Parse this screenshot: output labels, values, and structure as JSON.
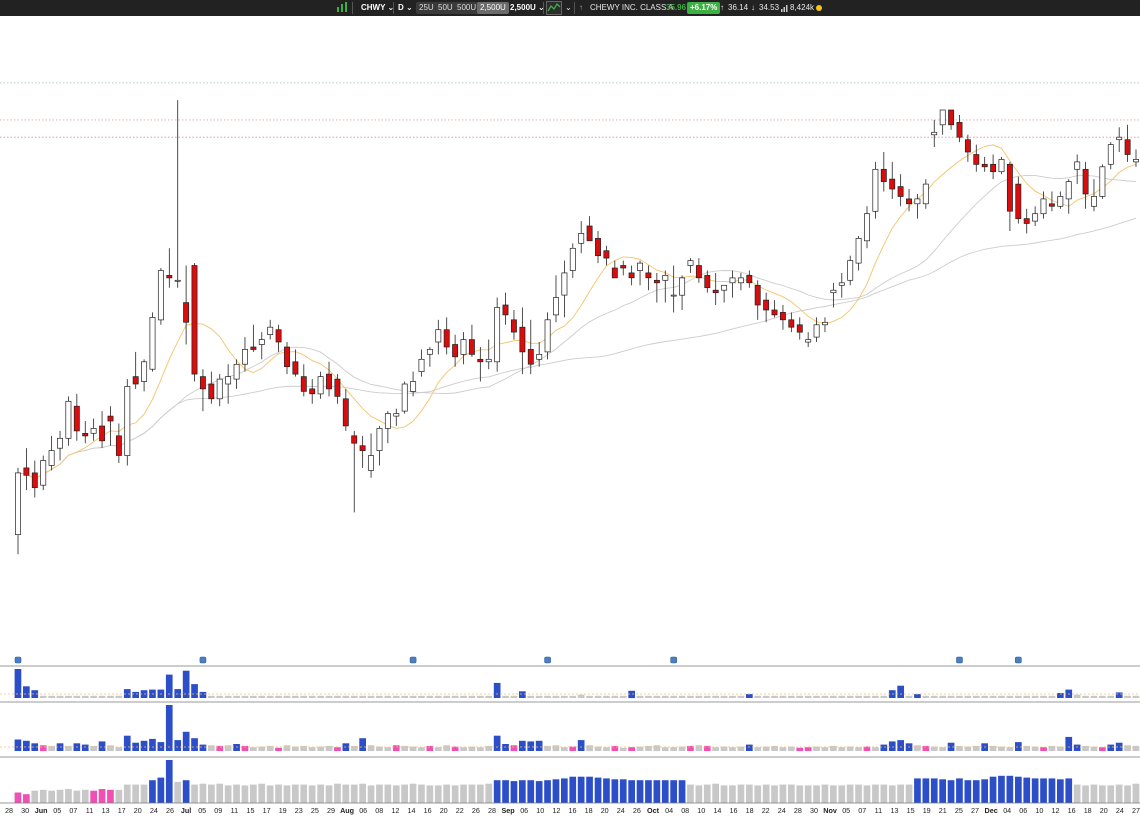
{
  "toolbar": {
    "symbol": "CHWY",
    "interval": "D",
    "range_buttons": [
      "25U",
      "50U",
      "500U",
      "2,500U"
    ],
    "active_range": "2,500U",
    "bars_selector": "2,500U",
    "company_name": "CHEWY INC. CLASS A",
    "last_price": "35.96",
    "change_pct": "+6.17%",
    "high": "36.14",
    "low": "34.53",
    "volume": "8,424k",
    "up_color": "#3cb043",
    "status_color": "#f5c518"
  },
  "colors": {
    "down_candle": "#d90d0d",
    "up_candle": "#ffffff",
    "volume_blue": "#2c4fc9",
    "volume_gray": "#c8c8c8",
    "volume_pink": "#f050b4",
    "ma_short": "#f3c46a",
    "ma_long": "#cccccc"
  },
  "chart_data": {
    "type": "candlestick",
    "symbol": "CHWY",
    "x_tick_labels": [
      "28",
      "30",
      "Jun",
      "05",
      "07",
      "11",
      "13",
      "17",
      "20",
      "24",
      "26",
      "Jul",
      "05",
      "09",
      "11",
      "15",
      "17",
      "19",
      "23",
      "25",
      "29",
      "Aug",
      "06",
      "08",
      "12",
      "14",
      "16",
      "20",
      "22",
      "26",
      "28",
      "Sep",
      "06",
      "10",
      "12",
      "16",
      "18",
      "20",
      "24",
      "26",
      "Oct",
      "04",
      "08",
      "10",
      "14",
      "16",
      "18",
      "22",
      "24",
      "28",
      "30",
      "Nov",
      "05",
      "07",
      "11",
      "13",
      "15",
      "19",
      "21",
      "25",
      "27",
      "Dec",
      "04",
      "06",
      "10",
      "12",
      "16",
      "18",
      "20",
      "24",
      "27"
    ],
    "price_range": [
      16.5,
      40.0
    ],
    "candles": [
      [
        19.8,
        22.5,
        19.0,
        22.3
      ],
      [
        22.5,
        23.3,
        21.6,
        22.2
      ],
      [
        22.3,
        22.8,
        21.3,
        21.7
      ],
      [
        21.8,
        23.0,
        21.6,
        22.8
      ],
      [
        22.6,
        23.8,
        22.4,
        23.2
      ],
      [
        23.3,
        24.0,
        22.8,
        23.7
      ],
      [
        23.7,
        25.4,
        23.4,
        25.2
      ],
      [
        25.0,
        25.5,
        23.6,
        24.0
      ],
      [
        23.9,
        24.4,
        23.5,
        23.8
      ],
      [
        23.9,
        24.5,
        23.6,
        24.1
      ],
      [
        24.2,
        24.8,
        23.3,
        23.6
      ],
      [
        24.6,
        25.0,
        23.4,
        24.4
      ],
      [
        23.8,
        24.3,
        22.7,
        23.0
      ],
      [
        23.0,
        26.1,
        22.6,
        25.8
      ],
      [
        26.2,
        27.2,
        25.7,
        25.9
      ],
      [
        26.0,
        26.9,
        25.6,
        26.8
      ],
      [
        26.5,
        28.8,
        26.4,
        28.6
      ],
      [
        28.5,
        30.6,
        28.3,
        30.5
      ],
      [
        30.3,
        31.4,
        29.8,
        30.2
      ],
      [
        30.1,
        37.4,
        29.8,
        30.1
      ],
      [
        29.2,
        30.7,
        27.5,
        28.4
      ],
      [
        30.7,
        30.8,
        26.0,
        26.3
      ],
      [
        26.2,
        26.5,
        24.8,
        25.7
      ],
      [
        25.9,
        26.4,
        25.1,
        25.3
      ],
      [
        25.3,
        26.3,
        25.0,
        26.1
      ],
      [
        25.9,
        26.7,
        25.1,
        26.2
      ],
      [
        26.1,
        26.9,
        25.7,
        26.7
      ],
      [
        26.7,
        27.8,
        26.4,
        27.3
      ],
      [
        27.4,
        28.3,
        27.2,
        27.3
      ],
      [
        27.5,
        28.0,
        26.9,
        27.7
      ],
      [
        27.9,
        28.5,
        27.7,
        28.2
      ],
      [
        28.1,
        28.3,
        27.2,
        27.6
      ],
      [
        27.4,
        27.6,
        26.3,
        26.6
      ],
      [
        26.8,
        27.3,
        26.2,
        26.3
      ],
      [
        26.2,
        26.7,
        25.4,
        25.6
      ],
      [
        25.7,
        26.1,
        25.1,
        25.5
      ],
      [
        25.5,
        26.4,
        25.3,
        26.2
      ],
      [
        26.3,
        26.8,
        25.4,
        25.7
      ],
      [
        26.1,
        26.3,
        25.1,
        25.4
      ],
      [
        25.3,
        25.7,
        24.0,
        24.2
      ],
      [
        23.8,
        24.0,
        20.7,
        23.5
      ],
      [
        23.4,
        23.8,
        22.5,
        23.2
      ],
      [
        22.4,
        23.9,
        22.1,
        23.0
      ],
      [
        23.2,
        24.2,
        22.6,
        24.1
      ],
      [
        24.1,
        24.8,
        23.5,
        24.7
      ],
      [
        24.6,
        24.9,
        24.2,
        24.7
      ],
      [
        24.8,
        26.0,
        24.7,
        25.9
      ],
      [
        25.6,
        26.4,
        25.4,
        26.0
      ],
      [
        26.4,
        27.3,
        26.2,
        26.9
      ],
      [
        27.1,
        27.4,
        26.6,
        27.3
      ],
      [
        27.6,
        28.5,
        27.1,
        28.1
      ],
      [
        28.1,
        28.6,
        27.1,
        27.4
      ],
      [
        27.5,
        27.9,
        26.6,
        27.0
      ],
      [
        27.1,
        28.0,
        26.7,
        27.7
      ],
      [
        27.7,
        28.3,
        27.0,
        27.1
      ],
      [
        26.9,
        27.4,
        26.0,
        26.8
      ],
      [
        26.8,
        27.7,
        26.5,
        26.9
      ],
      [
        26.8,
        29.4,
        26.4,
        29.0
      ],
      [
        29.1,
        29.6,
        28.3,
        28.7
      ],
      [
        28.5,
        28.9,
        27.7,
        28.0
      ],
      [
        28.2,
        29.0,
        26.3,
        27.2
      ],
      [
        27.3,
        28.5,
        26.3,
        26.7
      ],
      [
        26.9,
        27.6,
        26.6,
        27.1
      ],
      [
        27.2,
        28.8,
        26.9,
        28.5
      ],
      [
        28.7,
        30.3,
        28.4,
        29.4
      ],
      [
        29.5,
        30.9,
        28.6,
        30.4
      ],
      [
        30.5,
        31.6,
        30.2,
        31.4
      ],
      [
        31.6,
        32.5,
        31.2,
        32.0
      ],
      [
        32.3,
        32.7,
        31.8,
        31.7
      ],
      [
        31.8,
        32.1,
        30.8,
        31.1
      ],
      [
        31.3,
        31.5,
        30.7,
        31.0
      ],
      [
        30.6,
        30.9,
        30.2,
        30.2
      ],
      [
        30.7,
        30.9,
        30.3,
        30.6
      ],
      [
        30.4,
        30.7,
        29.9,
        30.2
      ],
      [
        30.5,
        30.9,
        29.9,
        30.8
      ],
      [
        30.4,
        30.7,
        29.7,
        30.2
      ],
      [
        30.1,
        30.4,
        29.2,
        30.0
      ],
      [
        30.1,
        30.5,
        29.2,
        30.3
      ],
      [
        29.5,
        30.7,
        28.8,
        29.5
      ],
      [
        29.5,
        30.3,
        28.9,
        30.2
      ],
      [
        30.7,
        31.0,
        30.4,
        30.9
      ],
      [
        30.7,
        31.0,
        30.0,
        30.2
      ],
      [
        30.3,
        30.5,
        29.6,
        29.8
      ],
      [
        29.7,
        30.4,
        29.1,
        29.6
      ],
      [
        29.7,
        29.9,
        29.2,
        29.9
      ],
      [
        30.0,
        30.5,
        29.4,
        30.2
      ],
      [
        30.0,
        30.4,
        29.7,
        30.2
      ],
      [
        30.3,
        30.5,
        29.8,
        30.0
      ],
      [
        29.9,
        30.1,
        28.5,
        29.1
      ],
      [
        29.3,
        29.6,
        28.4,
        28.9
      ],
      [
        28.9,
        29.3,
        28.6,
        28.7
      ],
      [
        28.8,
        29.1,
        28.1,
        28.5
      ],
      [
        28.5,
        28.8,
        28.0,
        28.2
      ],
      [
        28.3,
        28.6,
        27.7,
        28.0
      ],
      [
        27.6,
        28.0,
        27.4,
        27.7
      ],
      [
        27.8,
        28.6,
        27.6,
        28.3
      ],
      [
        28.3,
        28.6,
        28.0,
        28.4
      ],
      [
        29.6,
        30.0,
        29.0,
        29.7
      ],
      [
        29.9,
        30.4,
        29.4,
        30.0
      ],
      [
        30.1,
        31.1,
        29.9,
        30.9
      ],
      [
        30.8,
        31.9,
        30.5,
        31.8
      ],
      [
        31.7,
        33.1,
        31.4,
        32.8
      ],
      [
        32.9,
        34.9,
        32.6,
        34.6
      ],
      [
        34.6,
        35.3,
        33.7,
        34.1
      ],
      [
        34.2,
        34.9,
        33.4,
        33.8
      ],
      [
        33.9,
        34.4,
        33.1,
        33.5
      ],
      [
        33.4,
        33.8,
        32.9,
        33.2
      ],
      [
        33.2,
        33.6,
        32.6,
        33.4
      ],
      [
        33.2,
        34.2,
        33.0,
        34.0
      ],
      [
        36.0,
        36.6,
        35.5,
        36.1
      ],
      [
        36.4,
        37.0,
        36.0,
        37.0
      ],
      [
        37.0,
        37.0,
        36.2,
        36.4
      ],
      [
        36.5,
        36.8,
        35.7,
        35.9
      ],
      [
        35.8,
        36.0,
        34.9,
        35.3
      ],
      [
        35.2,
        35.6,
        34.5,
        34.8
      ],
      [
        34.8,
        35.1,
        34.5,
        34.7
      ],
      [
        34.8,
        35.2,
        34.2,
        34.5
      ],
      [
        34.5,
        35.1,
        34.4,
        35.0
      ],
      [
        34.8,
        34.9,
        32.1,
        32.9
      ],
      [
        34.0,
        34.3,
        32.4,
        32.6
      ],
      [
        32.6,
        33.0,
        32.0,
        32.4
      ],
      [
        32.5,
        33.1,
        32.3,
        32.8
      ],
      [
        32.8,
        33.7,
        32.6,
        33.4
      ],
      [
        33.2,
        33.7,
        32.9,
        33.1
      ],
      [
        33.1,
        33.7,
        33.0,
        33.5
      ],
      [
        33.4,
        34.2,
        32.8,
        34.1
      ],
      [
        34.6,
        35.2,
        34.0,
        34.9
      ],
      [
        34.6,
        34.9,
        33.0,
        33.6
      ],
      [
        33.1,
        34.2,
        32.9,
        33.5
      ],
      [
        33.5,
        34.8,
        33.4,
        34.7
      ],
      [
        34.8,
        35.7,
        34.6,
        35.6
      ],
      [
        35.8,
        36.3,
        35.3,
        35.9
      ],
      [
        35.8,
        36.4,
        34.9,
        35.2
      ],
      [
        34.9,
        35.4,
        34.7,
        35.0
      ]
    ],
    "moving_averages": [
      "short (orange)",
      "medium (gray)",
      "long (gray)"
    ],
    "horizontal_lines": [
      {
        "price": 38.1,
        "style": "dotted",
        "color": "#9fb7ad"
      },
      {
        "price": 36.6,
        "style": "dotted",
        "color": "#f0a0a0"
      },
      {
        "price": 35.9,
        "style": "dotted",
        "color": "#e88a8a"
      }
    ],
    "event_markers": [
      0,
      22,
      47,
      63,
      78,
      112,
      119,
      134,
      139
    ],
    "volume_panel_1": [
      5.2,
      2.1,
      1.4,
      0.4,
      0.4,
      0.4,
      0.4,
      0.4,
      0.4,
      0.4,
      0.4,
      0.4,
      0.4,
      1.6,
      1.1,
      1.4,
      1.5,
      1.5,
      4.2,
      1.6,
      4.9,
      2.5,
      1.1,
      0.4,
      0.4,
      0.4,
      0.4,
      0.4,
      0.4,
      0.4,
      0.4,
      0.4,
      0.4,
      0.4,
      0.4,
      0.4,
      0.4,
      0.4,
      0.4,
      0.4,
      0.4,
      0.4,
      0.4,
      0.4,
      0.4,
      0.4,
      0.4,
      0.4,
      0.4,
      0.4,
      0.4,
      0.4,
      0.4,
      0.4,
      0.4,
      0.4,
      0.4,
      2.7,
      0.4,
      0.4,
      1.2,
      0.4,
      0.4,
      0.4,
      0.4,
      0.4,
      0.4,
      0.6,
      0.4,
      0.4,
      0.4,
      0.4,
      0.4,
      1.3,
      0.4,
      0.4,
      0.4,
      0.4,
      0.4,
      0.4,
      0.4,
      0.4,
      0.4,
      0.4,
      0.4,
      0.4,
      0.4,
      0.7,
      0.4,
      0.4,
      0.4,
      0.4,
      0.4,
      0.4,
      0.4,
      0.4,
      0.4,
      0.4,
      0.4,
      0.4,
      0.4,
      0.4,
      0.4,
      0.4,
      1.4,
      2.2,
      0.4,
      0.7,
      0.4,
      0.4,
      0.4,
      0.4,
      0.4,
      0.4,
      0.4,
      0.4,
      0.4,
      0.4,
      0.4,
      0.4,
      0.4,
      0.4,
      0.4,
      0.4,
      0.9,
      1.5,
      0.6,
      0.4,
      0.4,
      0.4,
      0.4,
      1.0,
      0.4,
      0.4,
      0.4,
      0.4,
      0.4,
      1.2,
      0.4,
      0.4,
      0.4,
      0.4
    ],
    "volume_panel_2": [
      1.8,
      1.6,
      1.2,
      0.9,
      0.8,
      1.2,
      0.8,
      1.2,
      1.0,
      0.8,
      1.5,
      0.9,
      0.6,
      2.4,
      1.3,
      1.6,
      1.9,
      1.4,
      7.2,
      1.7,
      3.0,
      2.0,
      1.0,
      0.9,
      0.8,
      0.9,
      1.1,
      0.8,
      0.6,
      0.7,
      0.8,
      0.5,
      0.9,
      0.7,
      0.8,
      0.6,
      0.7,
      0.8,
      0.6,
      1.2,
      0.8,
      2.0,
      0.9,
      0.7,
      0.6,
      0.9,
      0.8,
      0.7,
      0.6,
      0.8,
      0.6,
      0.9,
      0.7,
      0.6,
      0.7,
      0.6,
      0.8,
      2.4,
      1.1,
      0.9,
      1.6,
      1.5,
      1.6,
      0.8,
      0.9,
      0.6,
      0.7,
      1.7,
      0.9,
      0.7,
      0.6,
      0.8,
      0.5,
      0.6,
      0.7,
      0.8,
      0.9,
      0.6,
      0.6,
      0.7,
      0.8,
      0.9,
      0.8,
      0.6,
      0.7,
      0.6,
      0.7,
      1.0,
      0.6,
      0.7,
      0.8,
      0.6,
      0.7,
      0.5,
      0.6,
      0.7,
      0.6,
      0.8,
      0.6,
      0.7,
      0.6,
      0.7,
      0.6,
      1.0,
      1.5,
      1.7,
      1.2,
      0.9,
      0.8,
      0.7,
      0.6,
      1.3,
      0.8,
      0.7,
      0.8,
      1.2,
      0.8,
      0.7,
      0.6,
      1.4,
      0.8,
      0.7,
      0.6,
      0.8,
      0.7,
      2.2,
      1.0,
      0.8,
      0.7,
      0.6,
      1.0,
      1.3,
      0.9,
      0.8,
      0.7,
      0.6,
      0.8,
      1.2,
      0.9,
      0.8,
      0.7,
      0.6
    ],
    "volume_panel_3": [
      1.2,
      1.0,
      1.4,
      1.5,
      1.4,
      1.5,
      1.6,
      1.4,
      1.5,
      1.4,
      1.6,
      1.5,
      1.5,
      2.1,
      2.1,
      2.1,
      2.6,
      2.9,
      4.9,
      2.4,
      2.6,
      2.1,
      2.2,
      2.1,
      2.2,
      2.0,
      2.1,
      2.0,
      2.1,
      2.2,
      2.0,
      2.1,
      2.0,
      2.1,
      2.1,
      2.0,
      2.1,
      2.0,
      2.2,
      2.1,
      2.1,
      2.2,
      2.0,
      2.1,
      2.1,
      2.0,
      2.1,
      2.2,
      2.1,
      2.0,
      2.0,
      2.1,
      2.0,
      2.1,
      2.1,
      2.1,
      2.2,
      2.6,
      2.6,
      2.5,
      2.6,
      2.6,
      2.5,
      2.6,
      2.7,
      2.8,
      3.0,
      3.0,
      3.0,
      2.9,
      2.8,
      2.7,
      2.7,
      2.6,
      2.6,
      2.6,
      2.6,
      2.6,
      2.6,
      2.6,
      2.1,
      2.0,
      2.1,
      2.2,
      2.0,
      2.0,
      2.1,
      2.1,
      2.0,
      2.1,
      2.0,
      2.1,
      2.1,
      2.0,
      2.0,
      2.0,
      2.1,
      2.0,
      2.0,
      2.1,
      2.1,
      2.0,
      2.1,
      2.1,
      2.0,
      2.1,
      2.1,
      2.8,
      2.8,
      2.8,
      2.7,
      2.6,
      2.8,
      2.6,
      2.6,
      2.7,
      3.0,
      3.1,
      3.1,
      3.0,
      2.9,
      2.8,
      2.8,
      2.8,
      2.7,
      2.8,
      2.1,
      2.0,
      2.1,
      2.0,
      2.0,
      2.1,
      2.0,
      2.2,
      2.1,
      2.0,
      2.0,
      2.1,
      2.0,
      2.1,
      2.0,
      2.2,
      2.1,
      2.0,
      2.6
    ]
  }
}
